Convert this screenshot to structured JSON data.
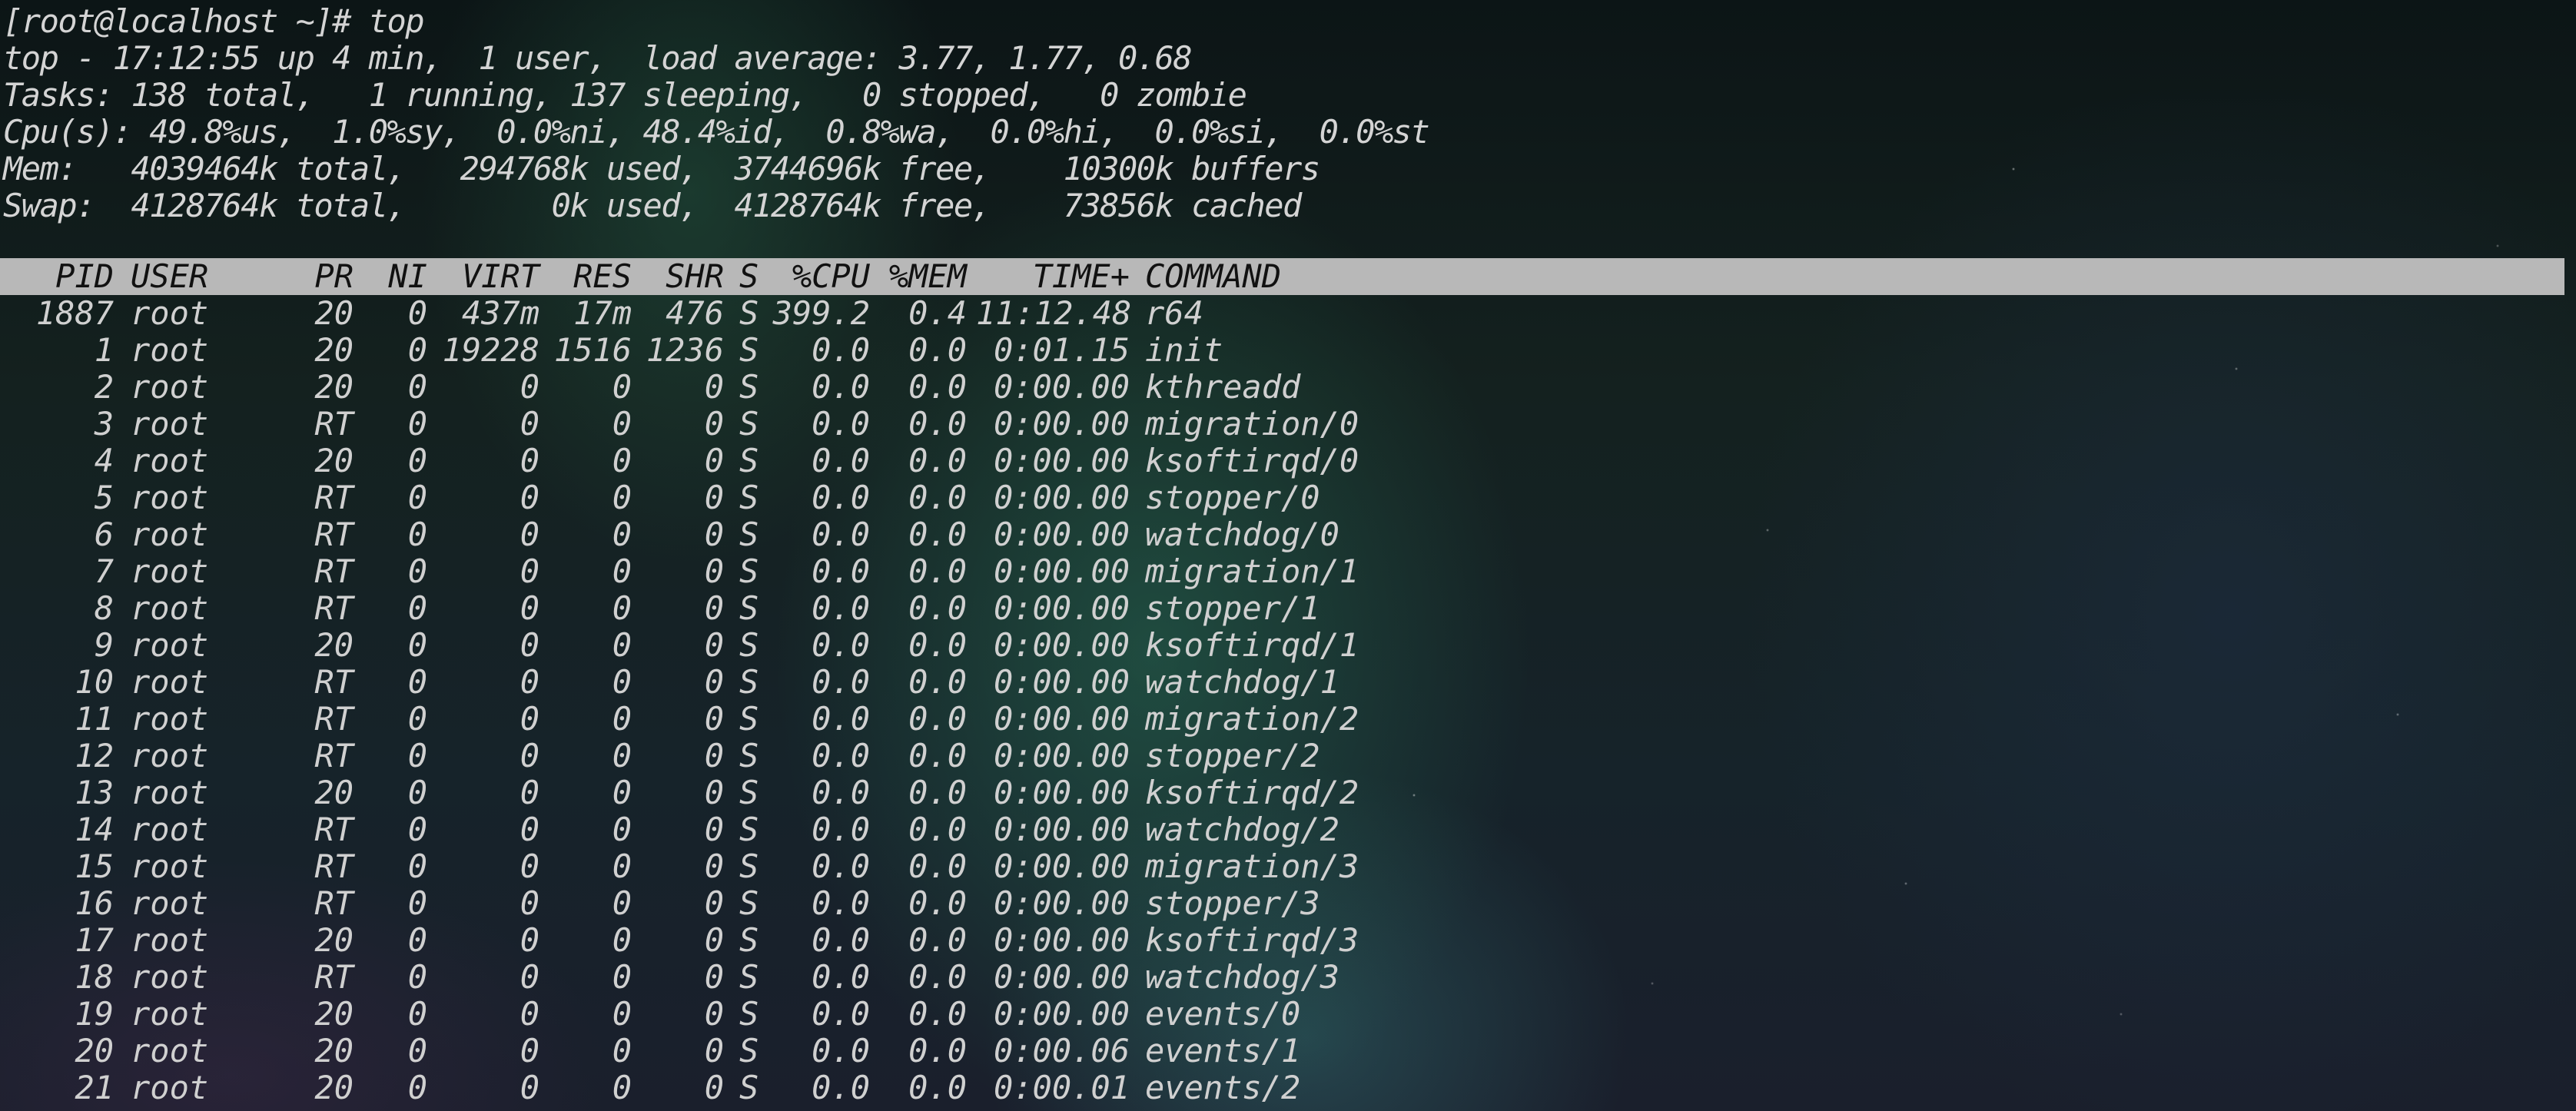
{
  "prompt_line": "[root@localhost ~]# top",
  "summary": {
    "uptime_line": "top - 17:12:55 up 4 min,  1 user,  load average: 3.77, 1.77, 0.68",
    "tasks_line": "Tasks: 138 total,   1 running, 137 sleeping,   0 stopped,   0 zombie",
    "cpu_line": "Cpu(s): 49.8%us,  1.0%sy,  0.0%ni, 48.4%id,  0.8%wa,  0.0%hi,  0.0%si,  0.0%st",
    "mem_line": "Mem:   4039464k total,   294768k used,  3744696k free,    10300k buffers",
    "swap_line": "Swap:  4128764k total,        0k used,  4128764k free,    73856k cached"
  },
  "columns": [
    "PID",
    "USER",
    "PR",
    "NI",
    "VIRT",
    "RES",
    "SHR",
    "S",
    "%CPU",
    "%MEM",
    "TIME+",
    "COMMAND"
  ],
  "processes": [
    {
      "pid": "1887",
      "user": "root",
      "pr": "20",
      "ni": "0",
      "virt": "437m",
      "res": "17m",
      "shr": "476",
      "s": "S",
      "cpu": "399.2",
      "mem": "0.4",
      "time": "11:12.48",
      "command": "r64"
    },
    {
      "pid": "1",
      "user": "root",
      "pr": "20",
      "ni": "0",
      "virt": "19228",
      "res": "1516",
      "shr": "1236",
      "s": "S",
      "cpu": "0.0",
      "mem": "0.0",
      "time": "0:01.15",
      "command": "init"
    },
    {
      "pid": "2",
      "user": "root",
      "pr": "20",
      "ni": "0",
      "virt": "0",
      "res": "0",
      "shr": "0",
      "s": "S",
      "cpu": "0.0",
      "mem": "0.0",
      "time": "0:00.00",
      "command": "kthreadd"
    },
    {
      "pid": "3",
      "user": "root",
      "pr": "RT",
      "ni": "0",
      "virt": "0",
      "res": "0",
      "shr": "0",
      "s": "S",
      "cpu": "0.0",
      "mem": "0.0",
      "time": "0:00.00",
      "command": "migration/0"
    },
    {
      "pid": "4",
      "user": "root",
      "pr": "20",
      "ni": "0",
      "virt": "0",
      "res": "0",
      "shr": "0",
      "s": "S",
      "cpu": "0.0",
      "mem": "0.0",
      "time": "0:00.00",
      "command": "ksoftirqd/0"
    },
    {
      "pid": "5",
      "user": "root",
      "pr": "RT",
      "ni": "0",
      "virt": "0",
      "res": "0",
      "shr": "0",
      "s": "S",
      "cpu": "0.0",
      "mem": "0.0",
      "time": "0:00.00",
      "command": "stopper/0"
    },
    {
      "pid": "6",
      "user": "root",
      "pr": "RT",
      "ni": "0",
      "virt": "0",
      "res": "0",
      "shr": "0",
      "s": "S",
      "cpu": "0.0",
      "mem": "0.0",
      "time": "0:00.00",
      "command": "watchdog/0"
    },
    {
      "pid": "7",
      "user": "root",
      "pr": "RT",
      "ni": "0",
      "virt": "0",
      "res": "0",
      "shr": "0",
      "s": "S",
      "cpu": "0.0",
      "mem": "0.0",
      "time": "0:00.00",
      "command": "migration/1"
    },
    {
      "pid": "8",
      "user": "root",
      "pr": "RT",
      "ni": "0",
      "virt": "0",
      "res": "0",
      "shr": "0",
      "s": "S",
      "cpu": "0.0",
      "mem": "0.0",
      "time": "0:00.00",
      "command": "stopper/1"
    },
    {
      "pid": "9",
      "user": "root",
      "pr": "20",
      "ni": "0",
      "virt": "0",
      "res": "0",
      "shr": "0",
      "s": "S",
      "cpu": "0.0",
      "mem": "0.0",
      "time": "0:00.00",
      "command": "ksoftirqd/1"
    },
    {
      "pid": "10",
      "user": "root",
      "pr": "RT",
      "ni": "0",
      "virt": "0",
      "res": "0",
      "shr": "0",
      "s": "S",
      "cpu": "0.0",
      "mem": "0.0",
      "time": "0:00.00",
      "command": "watchdog/1"
    },
    {
      "pid": "11",
      "user": "root",
      "pr": "RT",
      "ni": "0",
      "virt": "0",
      "res": "0",
      "shr": "0",
      "s": "S",
      "cpu": "0.0",
      "mem": "0.0",
      "time": "0:00.00",
      "command": "migration/2"
    },
    {
      "pid": "12",
      "user": "root",
      "pr": "RT",
      "ni": "0",
      "virt": "0",
      "res": "0",
      "shr": "0",
      "s": "S",
      "cpu": "0.0",
      "mem": "0.0",
      "time": "0:00.00",
      "command": "stopper/2"
    },
    {
      "pid": "13",
      "user": "root",
      "pr": "20",
      "ni": "0",
      "virt": "0",
      "res": "0",
      "shr": "0",
      "s": "S",
      "cpu": "0.0",
      "mem": "0.0",
      "time": "0:00.00",
      "command": "ksoftirqd/2"
    },
    {
      "pid": "14",
      "user": "root",
      "pr": "RT",
      "ni": "0",
      "virt": "0",
      "res": "0",
      "shr": "0",
      "s": "S",
      "cpu": "0.0",
      "mem": "0.0",
      "time": "0:00.00",
      "command": "watchdog/2"
    },
    {
      "pid": "15",
      "user": "root",
      "pr": "RT",
      "ni": "0",
      "virt": "0",
      "res": "0",
      "shr": "0",
      "s": "S",
      "cpu": "0.0",
      "mem": "0.0",
      "time": "0:00.00",
      "command": "migration/3"
    },
    {
      "pid": "16",
      "user": "root",
      "pr": "RT",
      "ni": "0",
      "virt": "0",
      "res": "0",
      "shr": "0",
      "s": "S",
      "cpu": "0.0",
      "mem": "0.0",
      "time": "0:00.00",
      "command": "stopper/3"
    },
    {
      "pid": "17",
      "user": "root",
      "pr": "20",
      "ni": "0",
      "virt": "0",
      "res": "0",
      "shr": "0",
      "s": "S",
      "cpu": "0.0",
      "mem": "0.0",
      "time": "0:00.00",
      "command": "ksoftirqd/3"
    },
    {
      "pid": "18",
      "user": "root",
      "pr": "RT",
      "ni": "0",
      "virt": "0",
      "res": "0",
      "shr": "0",
      "s": "S",
      "cpu": "0.0",
      "mem": "0.0",
      "time": "0:00.00",
      "command": "watchdog/3"
    },
    {
      "pid": "19",
      "user": "root",
      "pr": "20",
      "ni": "0",
      "virt": "0",
      "res": "0",
      "shr": "0",
      "s": "S",
      "cpu": "0.0",
      "mem": "0.0",
      "time": "0:00.00",
      "command": "events/0"
    },
    {
      "pid": "20",
      "user": "root",
      "pr": "20",
      "ni": "0",
      "virt": "0",
      "res": "0",
      "shr": "0",
      "s": "S",
      "cpu": "0.0",
      "mem": "0.0",
      "time": "0:00.06",
      "command": "events/1"
    },
    {
      "pid": "21",
      "user": "root",
      "pr": "20",
      "ni": "0",
      "virt": "0",
      "res": "0",
      "shr": "0",
      "s": "S",
      "cpu": "0.0",
      "mem": "0.0",
      "time": "0:00.01",
      "command": "events/2"
    }
  ],
  "colors": {
    "text": "#d0d0d0",
    "header_bar": "#b8b8b8",
    "header_text": "#111111"
  }
}
